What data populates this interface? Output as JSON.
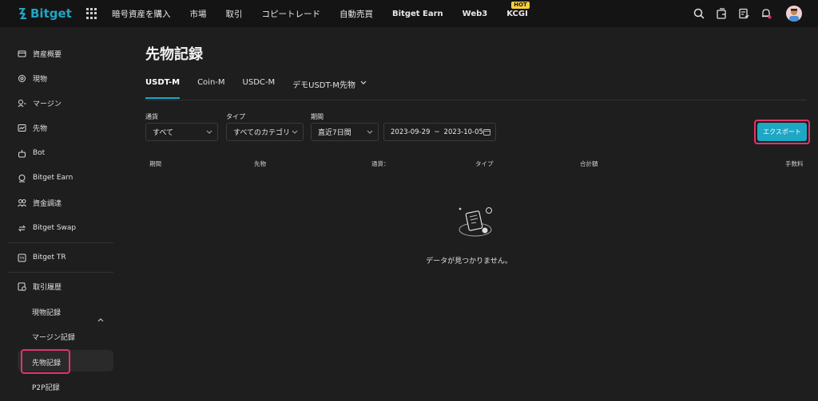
{
  "brand": {
    "name": "Bitget",
    "color": "#1ea7c5"
  },
  "nav": [
    {
      "label": "暗号資産を購入"
    },
    {
      "label": "市場"
    },
    {
      "label": "取引"
    },
    {
      "label": "コピートレード"
    },
    {
      "label": "自動売買"
    },
    {
      "label": "Bitget Earn"
    },
    {
      "label": "Web3"
    },
    {
      "label": "KCGI",
      "badge": "HOT"
    }
  ],
  "top_icons": [
    "search-icon",
    "wallet-icon",
    "orders-icon",
    "bell-icon",
    "avatar"
  ],
  "sidebar": {
    "items": [
      {
        "label": "資産概要",
        "icon": "assets-icon"
      },
      {
        "label": "現物",
        "icon": "spot-icon"
      },
      {
        "label": "マージン",
        "icon": "margin-icon"
      },
      {
        "label": "先物",
        "icon": "futures-icon"
      },
      {
        "label": "Bot",
        "icon": "bot-icon"
      },
      {
        "label": "Bitget Earn",
        "icon": "earn-icon"
      },
      {
        "label": "資金調達",
        "icon": "funding-icon"
      },
      {
        "label": "Bitget Swap",
        "icon": "swap-icon"
      },
      {
        "label": "Bitget TR",
        "icon": "tr-icon"
      },
      {
        "label": "取引履歴",
        "icon": "history-icon"
      }
    ],
    "sub_items": [
      {
        "label": "現物記録"
      },
      {
        "label": "マージン記録"
      },
      {
        "label": "先物記録"
      },
      {
        "label": "P2P記録"
      }
    ]
  },
  "main": {
    "title": "先物記録",
    "tabs": [
      {
        "label": "USDT-M",
        "active": true
      },
      {
        "label": "Coin-M"
      },
      {
        "label": "USDC-M"
      },
      {
        "label": "デモUSDT-M先物"
      }
    ],
    "filters": {
      "currency": {
        "label": "通貨",
        "value": "すべて"
      },
      "type": {
        "label": "タイプ",
        "value": "すべてのカテゴリ"
      },
      "period": {
        "label": "期間",
        "value": "直近7日間"
      },
      "date_from": "2023-09-29",
      "date_sep": "~",
      "date_to": "2023-10-05"
    },
    "export_label": "エクスポート",
    "columns": [
      "期間",
      "先物",
      "通貨：",
      "タイプ",
      "合計額",
      "手数料"
    ],
    "empty_text": "データが見つかりません。"
  },
  "colors": {
    "accent": "#1ea7c5",
    "highlight": "#e2336b",
    "hot_badge": "#f7d03c"
  }
}
